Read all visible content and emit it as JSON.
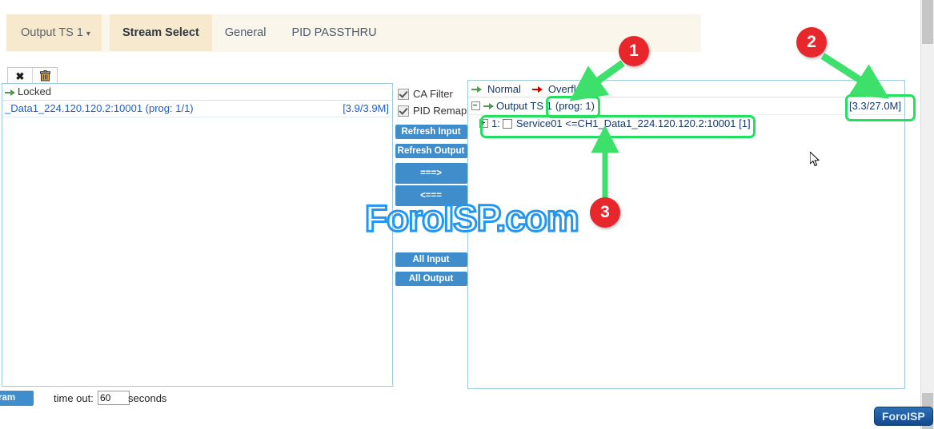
{
  "tabs": {
    "dropdown_label": "Output TS 1",
    "dropdown_caret": "▾",
    "items": [
      {
        "label": "Stream Select",
        "active": true
      },
      {
        "label": "General",
        "active": false
      },
      {
        "label": "PID PASSTHRU",
        "active": false
      }
    ]
  },
  "toolbar": {
    "close_icon": "close-icon",
    "close_glyph": "✖",
    "delete_icon": "trash-icon"
  },
  "left_panel": {
    "header": "Locked",
    "rows": [
      {
        "text": "_Data1_224.120.120.2:10001 (prog: 1/1)",
        "bandwidth": "[3.9/3.9M]"
      }
    ]
  },
  "middle_column": {
    "checkboxes": [
      {
        "label": "CA Filter",
        "checked": true
      },
      {
        "label": "PID Remap",
        "checked": true
      }
    ],
    "buttons": [
      "Refresh Input",
      "Refresh Output",
      "===>",
      "<===",
      "All Input",
      "All Output"
    ],
    "refresh_input": "Refresh Input",
    "refresh_output": "Refresh Output",
    "add_arrow": "===>",
    "remove_arrow": "<===",
    "all_input": "All Input",
    "all_output": "All Output"
  },
  "right_panel": {
    "legend": [
      {
        "label": "Normal",
        "color": "#4e9a4e"
      },
      {
        "label": "Overflow",
        "color": "#cc0000"
      }
    ],
    "root": {
      "title": "Output TS 1",
      "prog": "(prog: 1)",
      "bandwidth": "[3.3/27.0M]"
    },
    "children": [
      {
        "index": "1:",
        "name": "Service01 <=CH1_Data1_224.120.120.2:10001 [1]"
      }
    ]
  },
  "bottom": {
    "program_button": "gram",
    "timeout_label": "time out:",
    "timeout_value": "60",
    "timeout_placeholder": "60",
    "seconds_label": "seconds"
  },
  "badge": {
    "label": "ForoISP"
  },
  "watermark": {
    "text": "ForoISP.com"
  },
  "annotations": {
    "markers": [
      {
        "number": "1"
      },
      {
        "number": "2"
      },
      {
        "number": "3"
      }
    ],
    "highlight_color": "#23e05f",
    "marker_color": "#e8272d"
  }
}
